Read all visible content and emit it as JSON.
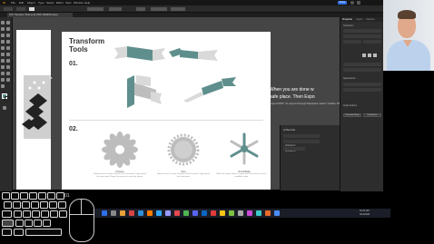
{
  "menubar": {
    "items": [
      "Ai",
      "File",
      "Edit",
      "Object",
      "Type",
      "Select",
      "Effect",
      "View",
      "Window",
      "Help"
    ],
    "share_label": "Share"
  },
  "doc_tab": {
    "label": "ATC Transform Tools.ai @ 150% (RGB/Preview)"
  },
  "artboard": {
    "title_line1": "Transform",
    "title_line2": "Tools",
    "row1": "01.",
    "row2": "02.",
    "shapes": [
      {
        "title": "Flower",
        "desc": "Rotate one of the shape. Repeat (Ctrl+D) to rotate & copy around the center point. Repeat the process to create the pattern."
      },
      {
        "title": "Sun",
        "desc": "Rotate one of the shape. Repeat (Ctrl+D) to rotate & copy around the center point."
      },
      {
        "title": "Snowflake",
        "desc": "Reflect the shape. Rotate & copy around the center to create a snowflake shape."
      }
    ]
  },
  "notice": {
    "line1": "When you are done w",
    "line2": "safe place. Then Expo",
    "line3": "Export PDF: To export through Illustrator select \"Adobe PDF\" from the list"
  },
  "properties_panel": {
    "tabs": [
      "Properties",
      "Layers",
      "Libraries"
    ],
    "section_transform": "Transform",
    "section_appearance": "Appearance",
    "section_quick_actions": "Quick Actions",
    "doc_setup_button": "Document Setup",
    "preferences_button": "Preferences"
  },
  "second_panel": {
    "title": "Artboards",
    "items": [
      "Artboard 1",
      "Artboard 2"
    ]
  },
  "taskbar": {
    "time": "10:21 AM",
    "date": "4/12/2024"
  },
  "keyboard_overlay": {
    "row1": [
      "",
      "",
      "",
      "",
      "",
      "",
      "",
      "01"
    ],
    "row2": [
      "",
      "",
      "",
      "",
      "",
      "",
      "",
      ""
    ],
    "row3": [
      "",
      "",
      "",
      "",
      "",
      "",
      ""
    ],
    "row4": [
      "",
      "",
      "",
      "",
      ""
    ]
  },
  "colors": {
    "teal": "#5f8f8c",
    "light_gray": "#d9d9d9",
    "mid_gray": "#bdbdbd",
    "accent_blue": "#2e6ee6"
  }
}
